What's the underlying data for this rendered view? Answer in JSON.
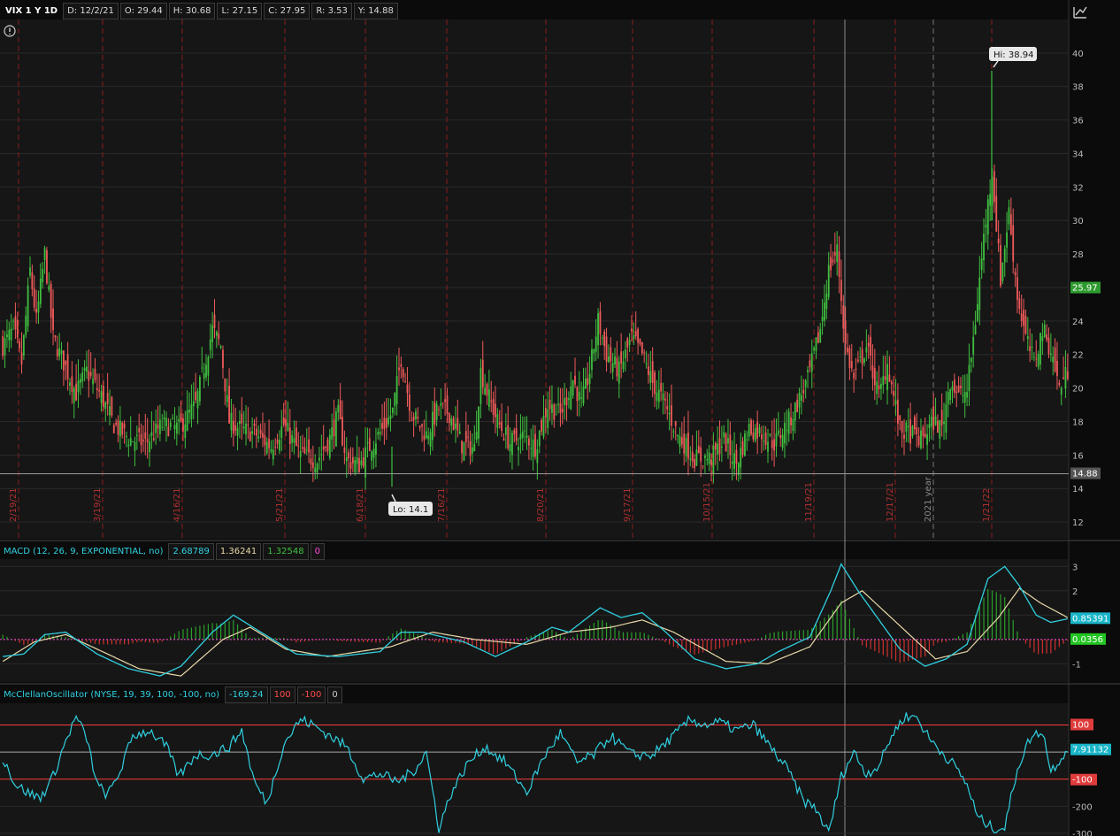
{
  "header": {
    "symbol": "VIX 1 Y 1D",
    "date": "D: 12/2/21",
    "open": "O: 29.44",
    "high": "H: 30.68",
    "low": "L: 27.15",
    "close": "C: 27.95",
    "range": "R: 3.53",
    "year_low": "Y: 14.88"
  },
  "macd_header": {
    "title": "MACD (12, 26, 9, EXPONENTIAL, no)",
    "value": "2.68789",
    "avg": "1.36241",
    "diff": "1.32548",
    "zero": "0"
  },
  "mco_header": {
    "title": "McClellanOscillator (NYSE, 19, 39, 100, -100, no)",
    "value": "-169.24",
    "upper": "100",
    "lower": "-100",
    "zero": "0"
  },
  "colors": {
    "background": "#0b0b0b",
    "up": "#3fbf3f",
    "down": "#f05a5a",
    "macd": "#2fd0e0",
    "avg": "#e8d8a8",
    "osc": "#2fd0e0",
    "level": "#ff3b3b",
    "grid": "#2a2a2a"
  },
  "chart_data": [
    {
      "type": "candlestick",
      "title": "VIX 1 Y 1D",
      "y_ticks": [
        12,
        14,
        16,
        18,
        20,
        22,
        24,
        26,
        28,
        30,
        32,
        34,
        36,
        38,
        40
      ],
      "ylim": [
        11,
        42
      ],
      "x_labels": [
        "2/19/21",
        "3/19/21",
        "4/16/21",
        "5/21/21",
        "6/18/21",
        "7/16/21",
        "8/20/21",
        "9/17/21",
        "10/15/21",
        "11/19/21",
        "12/17/21",
        "2021 year",
        "1/21/22"
      ],
      "hi_label": "Hi: 38.94",
      "lo_label": "Lo: 14.1",
      "last_price": "25.97",
      "year_low_line": "14.88",
      "anchors": [
        [
          0,
          22.5
        ],
        [
          5,
          23.5
        ],
        [
          9,
          21.5
        ],
        [
          13,
          27
        ],
        [
          16,
          24
        ],
        [
          20,
          28
        ],
        [
          24,
          23
        ],
        [
          29,
          21.5
        ],
        [
          35,
          19.7
        ],
        [
          40,
          21
        ],
        [
          47,
          19.5
        ],
        [
          53,
          17.8
        ],
        [
          60,
          17
        ],
        [
          68,
          16.7
        ],
        [
          76,
          17.8
        ],
        [
          84,
          17.6
        ],
        [
          92,
          19
        ],
        [
          100,
          23.5
        ],
        [
          104,
          22.5
        ],
        [
          108,
          18
        ],
        [
          114,
          17.5
        ],
        [
          120,
          17.3
        ],
        [
          128,
          16.5
        ],
        [
          134,
          17.8
        ],
        [
          142,
          16
        ],
        [
          150,
          15.7
        ],
        [
          156,
          17
        ],
        [
          160,
          18.4
        ],
        [
          164,
          15.7
        ],
        [
          170,
          15.4
        ],
        [
          175,
          16.5
        ],
        [
          181,
          17.5
        ],
        [
          186,
          18.6
        ],
        [
          190,
          21.8
        ],
        [
          195,
          18.5
        ],
        [
          202,
          17.2
        ],
        [
          208,
          18.8
        ],
        [
          213,
          18.5
        ],
        [
          219,
          16.6
        ],
        [
          225,
          16.4
        ],
        [
          228,
          21
        ],
        [
          232,
          19.4
        ],
        [
          236,
          18
        ],
        [
          242,
          16.7
        ],
        [
          249,
          17.2
        ],
        [
          254,
          16.5
        ],
        [
          260,
          19
        ],
        [
          266,
          18.4
        ],
        [
          272,
          20.5
        ],
        [
          276,
          19
        ],
        [
          280,
          21
        ],
        [
          284,
          24
        ],
        [
          288,
          22
        ],
        [
          294,
          21
        ],
        [
          300,
          23
        ],
        [
          305,
          22
        ],
        [
          310,
          20.3
        ],
        [
          316,
          19
        ],
        [
          322,
          17.2
        ],
        [
          330,
          15.8
        ],
        [
          338,
          15.8
        ],
        [
          344,
          16.9
        ],
        [
          350,
          15.5
        ],
        [
          356,
          17.6
        ],
        [
          362,
          17.3
        ],
        [
          368,
          16.7
        ],
        [
          376,
          18.2
        ],
        [
          384,
          20.5
        ],
        [
          390,
          23.5
        ],
        [
          394,
          27
        ],
        [
          398,
          28.2
        ],
        [
          402,
          22.5
        ],
        [
          406,
          20.5
        ],
        [
          412,
          22.5
        ],
        [
          418,
          19.5
        ],
        [
          422,
          21.5
        ],
        [
          428,
          17.5
        ],
        [
          434,
          17.2
        ],
        [
          438,
          16.9
        ],
        [
          444,
          18
        ],
        [
          448,
          17.6
        ],
        [
          452,
          20.5
        ],
        [
          456,
          19.5
        ],
        [
          460,
          19.8
        ],
        [
          464,
          24
        ],
        [
          468,
          29
        ],
        [
          472,
          33
        ],
        [
          476,
          26.5
        ],
        [
          480,
          30.5
        ],
        [
          484,
          25.5
        ],
        [
          488,
          23
        ],
        [
          492,
          21.5
        ],
        [
          496,
          23.5
        ],
        [
          500,
          22.3
        ],
        [
          504,
          20
        ],
        [
          508,
          21
        ]
      ]
    },
    {
      "type": "line",
      "title": "MACD (12, 26, 9, EXPONENTIAL, no)",
      "series": [
        {
          "name": "MACD",
          "anchors": [
            [
              0,
              -0.7
            ],
            [
              10,
              -0.6
            ],
            [
              20,
              0.2
            ],
            [
              30,
              0.3
            ],
            [
              45,
              -0.6
            ],
            [
              60,
              -1.2
            ],
            [
              75,
              -1.5
            ],
            [
              85,
              -1.1
            ],
            [
              100,
              0.3
            ],
            [
              110,
              1.0
            ],
            [
              125,
              0.2
            ],
            [
              140,
              -0.6
            ],
            [
              160,
              -0.7
            ],
            [
              180,
              -0.5
            ],
            [
              190,
              0.3
            ],
            [
              200,
              0.3
            ],
            [
              220,
              -0.1
            ],
            [
              235,
              -0.7
            ],
            [
              250,
              -0.1
            ],
            [
              262,
              0.5
            ],
            [
              270,
              0.3
            ],
            [
              285,
              1.3
            ],
            [
              295,
              0.9
            ],
            [
              305,
              1.1
            ],
            [
              315,
              0.4
            ],
            [
              330,
              -0.8
            ],
            [
              345,
              -1.2
            ],
            [
              360,
              -1.0
            ],
            [
              370,
              -0.5
            ],
            [
              385,
              0.1
            ],
            [
              395,
              2.0
            ],
            [
              400,
              3.1
            ],
            [
              408,
              2.0
            ],
            [
              418,
              0.8
            ],
            [
              428,
              -0.4
            ],
            [
              440,
              -1.1
            ],
            [
              450,
              -0.8
            ],
            [
              460,
              -0.2
            ],
            [
              470,
              2.5
            ],
            [
              478,
              3.0
            ],
            [
              485,
              2.2
            ],
            [
              493,
              1.0
            ],
            [
              500,
              0.7
            ],
            [
              508,
              0.85
            ]
          ]
        },
        {
          "name": "Avg",
          "anchors": [
            [
              0,
              -0.9
            ],
            [
              15,
              -0.1
            ],
            [
              30,
              0.2
            ],
            [
              45,
              -0.4
            ],
            [
              65,
              -1.2
            ],
            [
              85,
              -1.5
            ],
            [
              105,
              0.0
            ],
            [
              118,
              0.5
            ],
            [
              135,
              -0.4
            ],
            [
              155,
              -0.7
            ],
            [
              185,
              -0.3
            ],
            [
              205,
              0.3
            ],
            [
              225,
              0.0
            ],
            [
              250,
              -0.2
            ],
            [
              270,
              0.3
            ],
            [
              290,
              0.5
            ],
            [
              305,
              0.8
            ],
            [
              320,
              0.3
            ],
            [
              345,
              -0.9
            ],
            [
              365,
              -1.0
            ],
            [
              385,
              -0.3
            ],
            [
              400,
              1.5
            ],
            [
              410,
              2.0
            ],
            [
              425,
              0.8
            ],
            [
              445,
              -0.8
            ],
            [
              460,
              -0.5
            ],
            [
              475,
              0.9
            ],
            [
              485,
              2.1
            ],
            [
              495,
              1.5
            ],
            [
              508,
              0.9
            ]
          ]
        }
      ],
      "y_ticks": [
        -1,
        1,
        2,
        3
      ],
      "ylim": [
        -1.75,
        3.3
      ],
      "value_label": "0.85391",
      "diff_label": "0.0356"
    },
    {
      "type": "line",
      "title": "McClellanOscillator (NYSE, 19, 39, 100, -100, no)",
      "series": [
        {
          "name": "McClellanOscillator",
          "anchors": [
            [
              0,
              -20
            ],
            [
              6,
              -120
            ],
            [
              12,
              -150
            ],
            [
              18,
              -170
            ],
            [
              24,
              -90
            ],
            [
              30,
              40
            ],
            [
              35,
              130
            ],
            [
              40,
              50
            ],
            [
              45,
              -120
            ],
            [
              50,
              -160
            ],
            [
              56,
              -70
            ],
            [
              62,
              60
            ],
            [
              70,
              80
            ],
            [
              78,
              20
            ],
            [
              84,
              -90
            ],
            [
              92,
              -10
            ],
            [
              100,
              -10
            ],
            [
              108,
              20
            ],
            [
              114,
              80
            ],
            [
              120,
              -110
            ],
            [
              126,
              -190
            ],
            [
              134,
              30
            ],
            [
              142,
              120
            ],
            [
              148,
              100
            ],
            [
              156,
              60
            ],
            [
              164,
              20
            ],
            [
              172,
              -100
            ],
            [
              180,
              -80
            ],
            [
              188,
              -110
            ],
            [
              196,
              -70
            ],
            [
              202,
              0
            ],
            [
              208,
              -280
            ],
            [
              214,
              -150
            ],
            [
              222,
              -40
            ],
            [
              230,
              20
            ],
            [
              240,
              -40
            ],
            [
              250,
              -150
            ],
            [
              258,
              -20
            ],
            [
              266,
              70
            ],
            [
              274,
              -40
            ],
            [
              282,
              -10
            ],
            [
              290,
              60
            ],
            [
              300,
              -10
            ],
            [
              310,
              -10
            ],
            [
              320,
              60
            ],
            [
              328,
              120
            ],
            [
              335,
              100
            ],
            [
              342,
              110
            ],
            [
              350,
              80
            ],
            [
              358,
              100
            ],
            [
              366,
              20
            ],
            [
              374,
              -60
            ],
            [
              382,
              -180
            ],
            [
              388,
              -210
            ],
            [
              394,
              -300
            ],
            [
              400,
              -90
            ],
            [
              406,
              0
            ],
            [
              412,
              -80
            ],
            [
              418,
              -50
            ],
            [
              424,
              60
            ],
            [
              430,
              130
            ],
            [
              436,
              130
            ],
            [
              442,
              50
            ],
            [
              448,
              0
            ],
            [
              454,
              -50
            ],
            [
              460,
              -120
            ],
            [
              465,
              -240
            ],
            [
              472,
              -280
            ],
            [
              478,
              -280
            ],
            [
              484,
              -60
            ],
            [
              490,
              50
            ],
            [
              496,
              80
            ],
            [
              500,
              -70
            ],
            [
              506,
              -10
            ],
            [
              508,
              7.9
            ]
          ]
        }
      ],
      "y_ticks": [
        -300,
        -200
      ],
      "levels": [
        100,
        -100
      ],
      "ylim": [
        -310,
        180
      ],
      "value_label": "7.91132",
      "upper_label": "100",
      "lower_label": "-100"
    }
  ]
}
